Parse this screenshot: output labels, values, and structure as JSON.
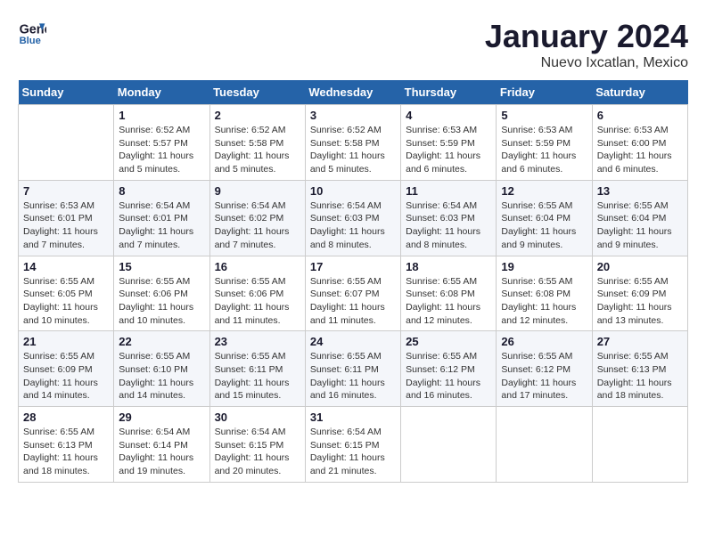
{
  "header": {
    "logo_line1": "General",
    "logo_line2": "Blue",
    "month": "January 2024",
    "location": "Nuevo Ixcatlan, Mexico"
  },
  "weekdays": [
    "Sunday",
    "Monday",
    "Tuesday",
    "Wednesday",
    "Thursday",
    "Friday",
    "Saturday"
  ],
  "weeks": [
    [
      {
        "num": "",
        "info": ""
      },
      {
        "num": "1",
        "info": "Sunrise: 6:52 AM\nSunset: 5:57 PM\nDaylight: 11 hours\nand 5 minutes."
      },
      {
        "num": "2",
        "info": "Sunrise: 6:52 AM\nSunset: 5:58 PM\nDaylight: 11 hours\nand 5 minutes."
      },
      {
        "num": "3",
        "info": "Sunrise: 6:52 AM\nSunset: 5:58 PM\nDaylight: 11 hours\nand 5 minutes."
      },
      {
        "num": "4",
        "info": "Sunrise: 6:53 AM\nSunset: 5:59 PM\nDaylight: 11 hours\nand 6 minutes."
      },
      {
        "num": "5",
        "info": "Sunrise: 6:53 AM\nSunset: 5:59 PM\nDaylight: 11 hours\nand 6 minutes."
      },
      {
        "num": "6",
        "info": "Sunrise: 6:53 AM\nSunset: 6:00 PM\nDaylight: 11 hours\nand 6 minutes."
      }
    ],
    [
      {
        "num": "7",
        "info": "Sunrise: 6:53 AM\nSunset: 6:01 PM\nDaylight: 11 hours\nand 7 minutes."
      },
      {
        "num": "8",
        "info": "Sunrise: 6:54 AM\nSunset: 6:01 PM\nDaylight: 11 hours\nand 7 minutes."
      },
      {
        "num": "9",
        "info": "Sunrise: 6:54 AM\nSunset: 6:02 PM\nDaylight: 11 hours\nand 7 minutes."
      },
      {
        "num": "10",
        "info": "Sunrise: 6:54 AM\nSunset: 6:03 PM\nDaylight: 11 hours\nand 8 minutes."
      },
      {
        "num": "11",
        "info": "Sunrise: 6:54 AM\nSunset: 6:03 PM\nDaylight: 11 hours\nand 8 minutes."
      },
      {
        "num": "12",
        "info": "Sunrise: 6:55 AM\nSunset: 6:04 PM\nDaylight: 11 hours\nand 9 minutes."
      },
      {
        "num": "13",
        "info": "Sunrise: 6:55 AM\nSunset: 6:04 PM\nDaylight: 11 hours\nand 9 minutes."
      }
    ],
    [
      {
        "num": "14",
        "info": "Sunrise: 6:55 AM\nSunset: 6:05 PM\nDaylight: 11 hours\nand 10 minutes."
      },
      {
        "num": "15",
        "info": "Sunrise: 6:55 AM\nSunset: 6:06 PM\nDaylight: 11 hours\nand 10 minutes."
      },
      {
        "num": "16",
        "info": "Sunrise: 6:55 AM\nSunset: 6:06 PM\nDaylight: 11 hours\nand 11 minutes."
      },
      {
        "num": "17",
        "info": "Sunrise: 6:55 AM\nSunset: 6:07 PM\nDaylight: 11 hours\nand 11 minutes."
      },
      {
        "num": "18",
        "info": "Sunrise: 6:55 AM\nSunset: 6:08 PM\nDaylight: 11 hours\nand 12 minutes."
      },
      {
        "num": "19",
        "info": "Sunrise: 6:55 AM\nSunset: 6:08 PM\nDaylight: 11 hours\nand 12 minutes."
      },
      {
        "num": "20",
        "info": "Sunrise: 6:55 AM\nSunset: 6:09 PM\nDaylight: 11 hours\nand 13 minutes."
      }
    ],
    [
      {
        "num": "21",
        "info": "Sunrise: 6:55 AM\nSunset: 6:09 PM\nDaylight: 11 hours\nand 14 minutes."
      },
      {
        "num": "22",
        "info": "Sunrise: 6:55 AM\nSunset: 6:10 PM\nDaylight: 11 hours\nand 14 minutes."
      },
      {
        "num": "23",
        "info": "Sunrise: 6:55 AM\nSunset: 6:11 PM\nDaylight: 11 hours\nand 15 minutes."
      },
      {
        "num": "24",
        "info": "Sunrise: 6:55 AM\nSunset: 6:11 PM\nDaylight: 11 hours\nand 16 minutes."
      },
      {
        "num": "25",
        "info": "Sunrise: 6:55 AM\nSunset: 6:12 PM\nDaylight: 11 hours\nand 16 minutes."
      },
      {
        "num": "26",
        "info": "Sunrise: 6:55 AM\nSunset: 6:12 PM\nDaylight: 11 hours\nand 17 minutes."
      },
      {
        "num": "27",
        "info": "Sunrise: 6:55 AM\nSunset: 6:13 PM\nDaylight: 11 hours\nand 18 minutes."
      }
    ],
    [
      {
        "num": "28",
        "info": "Sunrise: 6:55 AM\nSunset: 6:13 PM\nDaylight: 11 hours\nand 18 minutes."
      },
      {
        "num": "29",
        "info": "Sunrise: 6:54 AM\nSunset: 6:14 PM\nDaylight: 11 hours\nand 19 minutes."
      },
      {
        "num": "30",
        "info": "Sunrise: 6:54 AM\nSunset: 6:15 PM\nDaylight: 11 hours\nand 20 minutes."
      },
      {
        "num": "31",
        "info": "Sunrise: 6:54 AM\nSunset: 6:15 PM\nDaylight: 11 hours\nand 21 minutes."
      },
      {
        "num": "",
        "info": ""
      },
      {
        "num": "",
        "info": ""
      },
      {
        "num": "",
        "info": ""
      }
    ]
  ]
}
